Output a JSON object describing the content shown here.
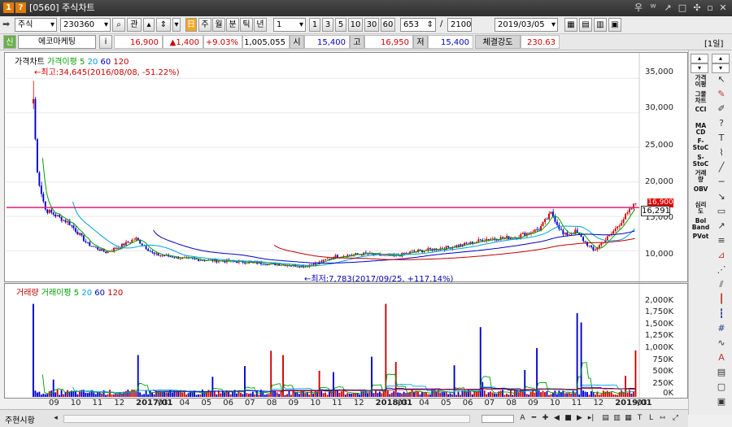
{
  "window": {
    "badge_num": "1",
    "badge_help": "?",
    "title": "[0560] 주식차트",
    "controls": [
      "우",
      "ᵂ",
      "↗",
      "□",
      "✣",
      "▫",
      "✕"
    ]
  },
  "toolbar": {
    "market": "주식",
    "code": "230360",
    "btn_gwan": "관",
    "periods": [
      "주",
      "월",
      "분",
      "틱",
      "년"
    ],
    "count_select": "1",
    "quick_counts": [
      "1",
      "3",
      "5",
      "10",
      "30",
      "60"
    ],
    "display_count": "653",
    "total_count": "2100",
    "date": "2019/03/05"
  },
  "quote": {
    "badge": "신",
    "name": "에코마케팅",
    "info_btn": "i",
    "price": "16,900",
    "change": "▲1,400",
    "change_pct": "+9.03%",
    "volume": "1,005,055",
    "open_label": "시",
    "open": "15,400",
    "high_label": "고",
    "high": "16,950",
    "low_label": "저",
    "low": "15,400",
    "strength_label": "체결강도",
    "strength": "230.63",
    "period_badge": "[1일]"
  },
  "price_panel": {
    "legend": {
      "main": "가격차트",
      "ma_label": "가격이평",
      "ma": [
        "5",
        "20",
        "60",
        "120"
      ]
    },
    "high_annotation": "←최고:34,645(2016/08/08, -51.22%)",
    "low_annotation": "←최저:7,783(2017/09/25, +117.14%)",
    "current_label": "16,291",
    "top_label": "16,900",
    "y_ticks": [
      "35,000",
      "30,000",
      "25,000",
      "20,000",
      "15,000",
      "10,000"
    ]
  },
  "volume_panel": {
    "legend": {
      "main": "거래량",
      "ma_label": "거래이평",
      "ma": [
        "5",
        "20",
        "60",
        "120"
      ]
    },
    "y_ticks": [
      "2,000K",
      "1,750K",
      "1,500K",
      "1,250K",
      "1,000K",
      "750K",
      "500K",
      "250K",
      "0K"
    ]
  },
  "x_axis": [
    "09",
    "10",
    "11",
    "12",
    "2017/01",
    "03",
    "04",
    "05",
    "06",
    "07",
    "08",
    "09",
    "10",
    "11",
    "12",
    "2018/01",
    "03",
    "04",
    "05",
    "06",
    "07",
    "08",
    "09",
    "10",
    "11",
    "12",
    "2019/01",
    "03"
  ],
  "status": {
    "tabs": "주현시황"
  },
  "right_strip": {
    "items": [
      "가격\n이평",
      "그물\n차트",
      "CCI",
      "MA\nCD",
      "F-\nStoC",
      "S-\nStoC",
      "거래\n량",
      "OBV",
      "심리\n도",
      "Bol\nBand",
      "PVot"
    ]
  },
  "colors": {
    "ma5": "#00a000",
    "ma20": "#00a0e0",
    "ma60": "#0000c0",
    "ma120": "#c00000",
    "up": "#d00000",
    "down": "#0000d0",
    "resistance": "#e0207a"
  },
  "chart_data": {
    "type": "candlestick",
    "price_axis": {
      "ylim": [
        7000,
        37000
      ],
      "ticks": [
        10000,
        15000,
        20000,
        25000,
        30000,
        35000
      ]
    },
    "volume_axis": {
      "ylim": [
        0,
        2150000
      ],
      "ticks": [
        0,
        250000,
        500000,
        750000,
        1000000,
        1250000,
        1500000,
        1750000,
        2000000
      ]
    },
    "high": {
      "value": 34645,
      "date": "2016/08/08"
    },
    "low": {
      "value": 7783,
      "date": "2017/09/25"
    },
    "current_label": 16291,
    "resistance_line": 16291,
    "close_path_x": [
      0,
      0.005,
      0.012,
      0.02,
      0.04,
      0.06,
      0.09,
      0.12,
      0.14,
      0.17,
      0.2,
      0.22,
      0.25,
      0.3,
      0.35,
      0.4,
      0.45,
      0.48,
      0.5,
      0.55,
      0.6,
      0.63,
      0.68,
      0.72,
      0.75,
      0.8,
      0.84,
      0.86,
      0.88,
      0.9,
      0.93,
      0.96,
      1.0
    ],
    "close_path_y": [
      34645,
      22000,
      19000,
      16000,
      15000,
      14000,
      11000,
      9800,
      10500,
      11800,
      9500,
      9300,
      8900,
      8600,
      8400,
      8100,
      7783,
      8500,
      9200,
      9600,
      9200,
      9900,
      10400,
      11000,
      11700,
      12000,
      13200,
      15500,
      12300,
      12800,
      10000,
      12500,
      16900
    ]
  }
}
